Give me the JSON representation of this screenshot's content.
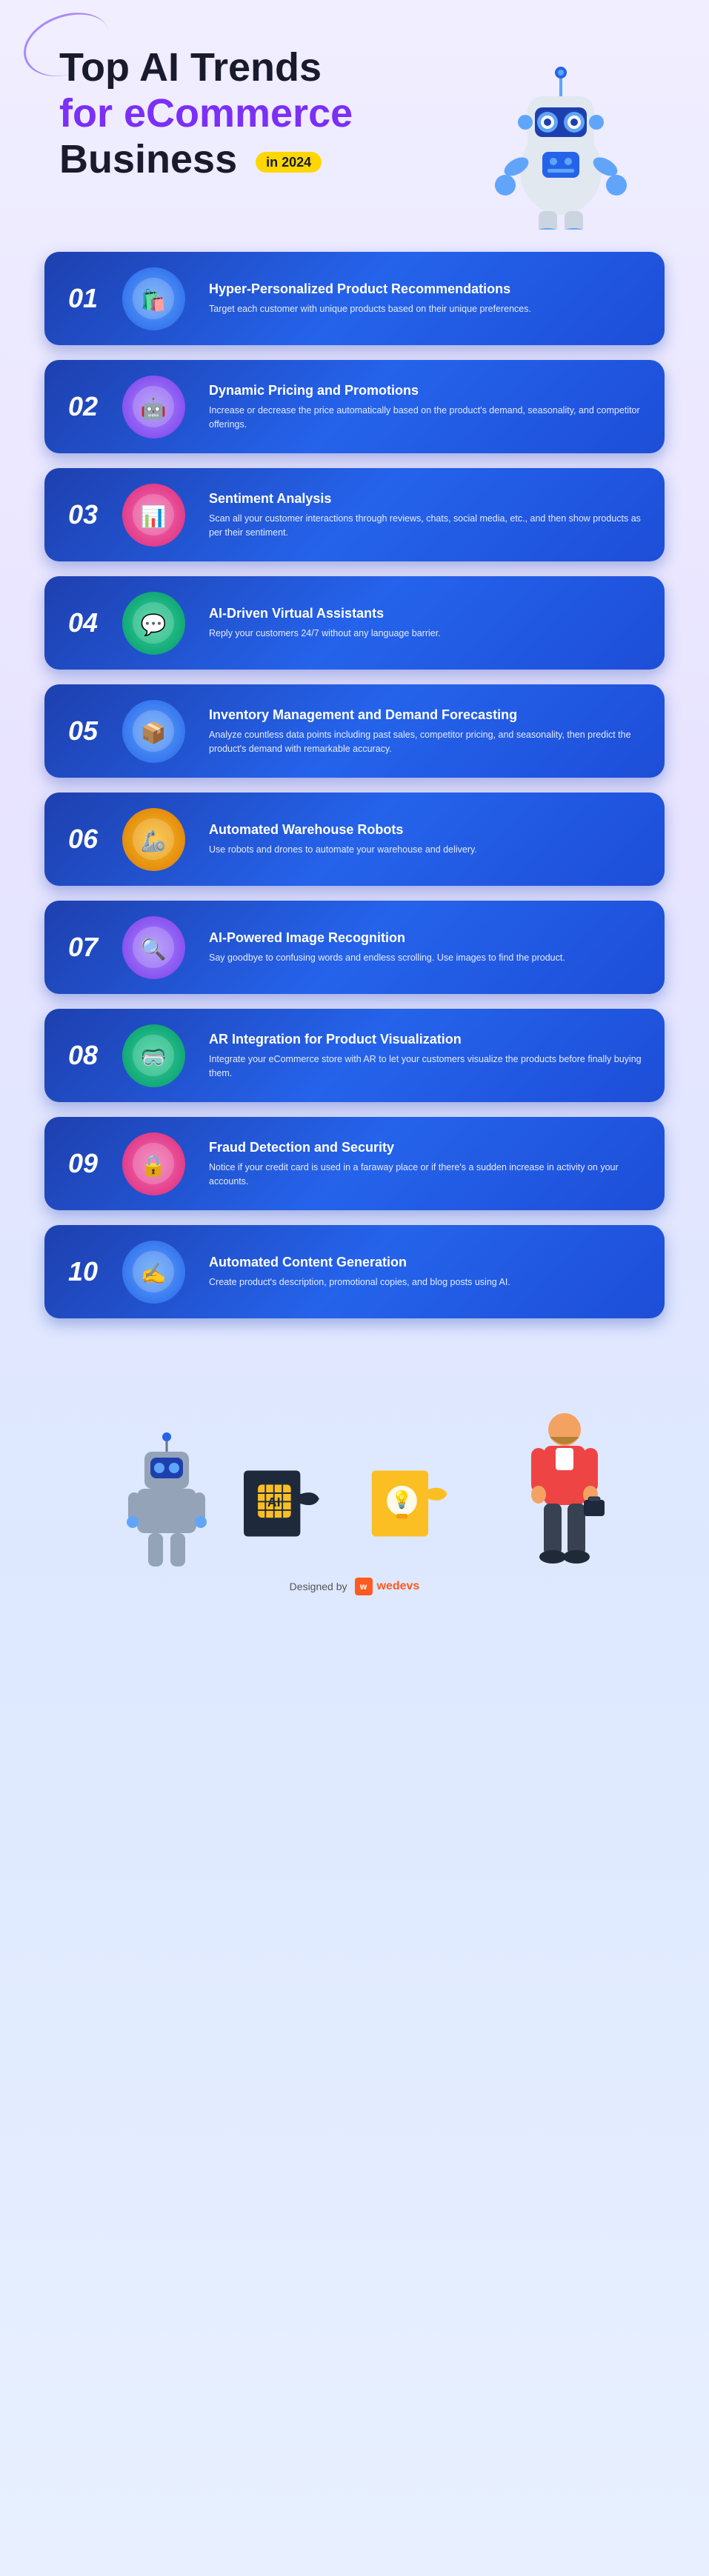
{
  "header": {
    "title_line1": "Top AI Trends",
    "title_line2": "for eCommerce",
    "title_line3": "Business",
    "year_badge": "in 2024"
  },
  "trends": [
    {
      "number": "01",
      "title": "Hyper-Personalized Product Recommendations",
      "description": "Target each customer with unique products based on their unique preferences.",
      "icon": "🛍️",
      "icon_class": "icon-01"
    },
    {
      "number": "02",
      "title": "Dynamic Pricing and Promotions",
      "description": "Increase or decrease the price automatically based on the product's demand, seasonality, and competitor offerings.",
      "icon": "🤖",
      "icon_class": "icon-02"
    },
    {
      "number": "03",
      "title": "Sentiment Analysis",
      "description": "Scan all your customer interactions through reviews, chats, social media, etc., and then show products as per their sentiment.",
      "icon": "📊",
      "icon_class": "icon-03"
    },
    {
      "number": "04",
      "title": "AI-Driven Virtual Assistants",
      "description": "Reply your customers 24/7 without any language barrier.",
      "icon": "💬",
      "icon_class": "icon-04"
    },
    {
      "number": "05",
      "title": "Inventory Management and Demand Forecasting",
      "description": "Analyze countless data points including past sales, competitor pricing, and seasonality, then predict the product's demand with remarkable accuracy.",
      "icon": "📦",
      "icon_class": "icon-05"
    },
    {
      "number": "06",
      "title": "Automated Warehouse Robots",
      "description": "Use robots and drones to automate your warehouse and delivery.",
      "icon": "🤖",
      "icon_class": "icon-06"
    },
    {
      "number": "07",
      "title": "AI-Powered Image Recognition",
      "description": "Say goodbye to confusing words and endless scrolling. Use images to find the product.",
      "icon": "🔍",
      "icon_class": "icon-07"
    },
    {
      "number": "08",
      "title": "AR Integration for Product Visualization",
      "description": "Integrate your eCommerce store with AR to let your customers visualize the products before finally buying them.",
      "icon": "🥽",
      "icon_class": "icon-08"
    },
    {
      "number": "09",
      "title": "Fraud Detection and Security",
      "description": "Notice if your credit card is used in a faraway place or if there's a sudden increase in activity on your accounts.",
      "icon": "🔒",
      "icon_class": "icon-09"
    },
    {
      "number": "10",
      "title": "Automated Content Generation",
      "description": "Create product's description, promotional copies, and blog posts using AI.",
      "icon": "✍️",
      "icon_class": "icon-10"
    }
  ],
  "footer": {
    "designed_by": "Designed by",
    "brand": "wedevs"
  }
}
